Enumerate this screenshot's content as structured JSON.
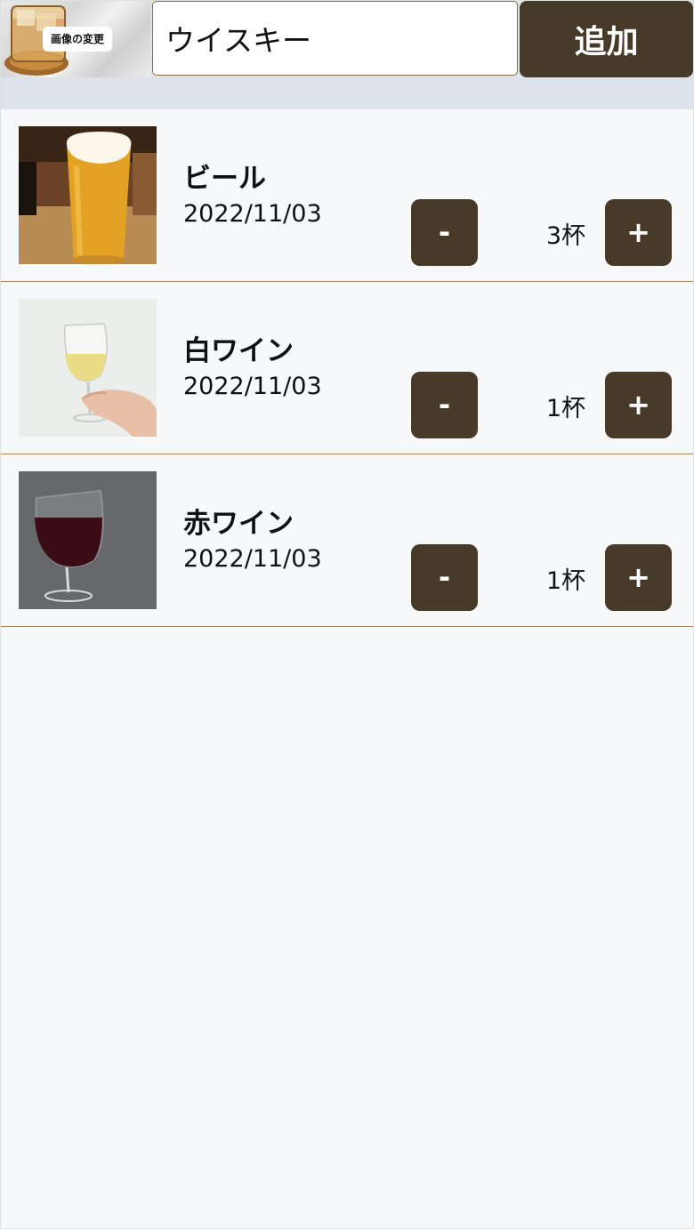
{
  "header": {
    "change_image_label": "画像の変更",
    "drink_name_value": "ウイスキー",
    "add_button_label": "追加"
  },
  "drinks": [
    {
      "name": "ビール",
      "date": "2022/11/03",
      "count": "3杯",
      "minus_label": "-",
      "plus_label": "+",
      "image": "beer-glass"
    },
    {
      "name": "白ワイン",
      "date": "2022/11/03",
      "count": "1杯",
      "minus_label": "-",
      "plus_label": "+",
      "image": "white-wine-glass"
    },
    {
      "name": "赤ワイン",
      "date": "2022/11/03",
      "count": "1杯",
      "minus_label": "-",
      "plus_label": "+",
      "image": "red-wine-glass"
    }
  ],
  "colors": {
    "button_brown": "#473a28",
    "divider_brown": "#a68556",
    "background": "#f6f8fa",
    "header_bar": "#dce3ea"
  }
}
